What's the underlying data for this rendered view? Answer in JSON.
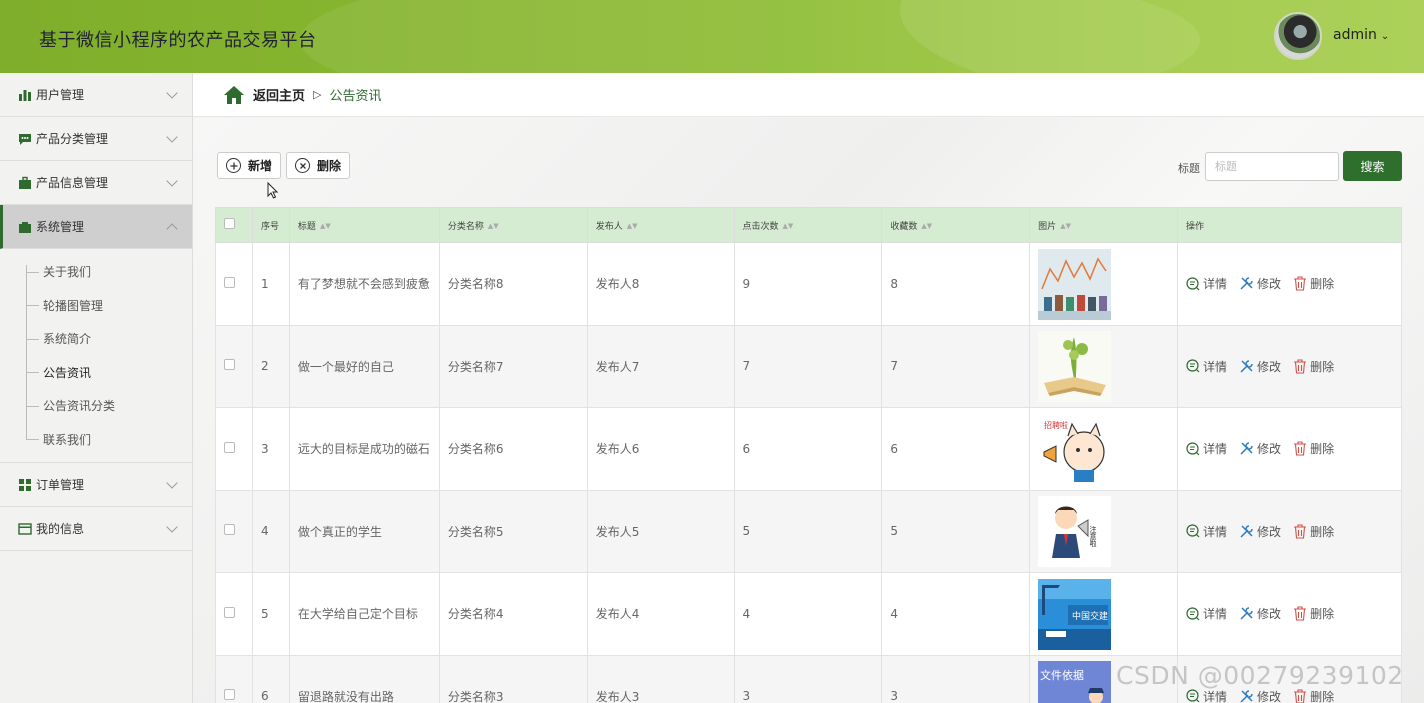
{
  "header": {
    "title": "基于微信小程序的农产品交易平台",
    "username": "admin"
  },
  "sidebar": {
    "items": [
      {
        "label": "用户管理",
        "icon": "bar-chart-icon"
      },
      {
        "label": "产品分类管理",
        "icon": "chat-icon"
      },
      {
        "label": "产品信息管理",
        "icon": "briefcase-icon"
      },
      {
        "label": "系统管理",
        "icon": "folder-icon",
        "open": true
      },
      {
        "label": "订单管理",
        "icon": "grid-icon"
      },
      {
        "label": "我的信息",
        "icon": "card-icon"
      }
    ],
    "submenu": [
      "关于我们",
      "轮播图管理",
      "系统简介",
      "公告资讯",
      "公告资讯分类",
      "联系我们"
    ],
    "active_sub": "公告资讯"
  },
  "breadcrumb": {
    "home": "返回主页",
    "current": "公告资讯"
  },
  "toolbar": {
    "add_label": "新增",
    "delete_label": "删除",
    "search_label": "标题",
    "search_placeholder": "标题",
    "search_button": "搜索"
  },
  "table": {
    "headers": [
      "序号",
      "标题",
      "分类名称",
      "发布人",
      "点击次数",
      "收藏数",
      "图片",
      "操作"
    ],
    "rows": [
      {
        "no": "1",
        "title": "有了梦想就不会感到疲惫",
        "category": "分类名称8",
        "publisher": "发布人8",
        "clicks": "9",
        "favorites": "8"
      },
      {
        "no": "2",
        "title": "做一个最好的自己",
        "category": "分类名称7",
        "publisher": "发布人7",
        "clicks": "7",
        "favorites": "7"
      },
      {
        "no": "3",
        "title": "远大的目标是成功的磁石",
        "category": "分类名称6",
        "publisher": "发布人6",
        "clicks": "6",
        "favorites": "6"
      },
      {
        "no": "4",
        "title": "做个真正的学生",
        "category": "分类名称5",
        "publisher": "发布人5",
        "clicks": "5",
        "favorites": "5"
      },
      {
        "no": "5",
        "title": "在大学给自己定个目标",
        "category": "分类名称4",
        "publisher": "发布人4",
        "clicks": "4",
        "favorites": "4"
      },
      {
        "no": "6",
        "title": "留退路就没有出路",
        "category": "分类名称3",
        "publisher": "发布人3",
        "clicks": "3",
        "favorites": "3"
      }
    ],
    "actions": {
      "detail": "详情",
      "edit": "修改",
      "delete": "删除"
    }
  },
  "images": {
    "img1_caption": "",
    "img2_caption": "",
    "img3_text": "招聘啦",
    "img4_text": "注意啦",
    "img5_text": "中国交建",
    "img6_text": "文件依据"
  },
  "watermark": "CSDN @00279239102",
  "colors": {
    "primary": "#2f6f2d",
    "header": "#8dbc33",
    "table_head": "#d6ecd2"
  }
}
